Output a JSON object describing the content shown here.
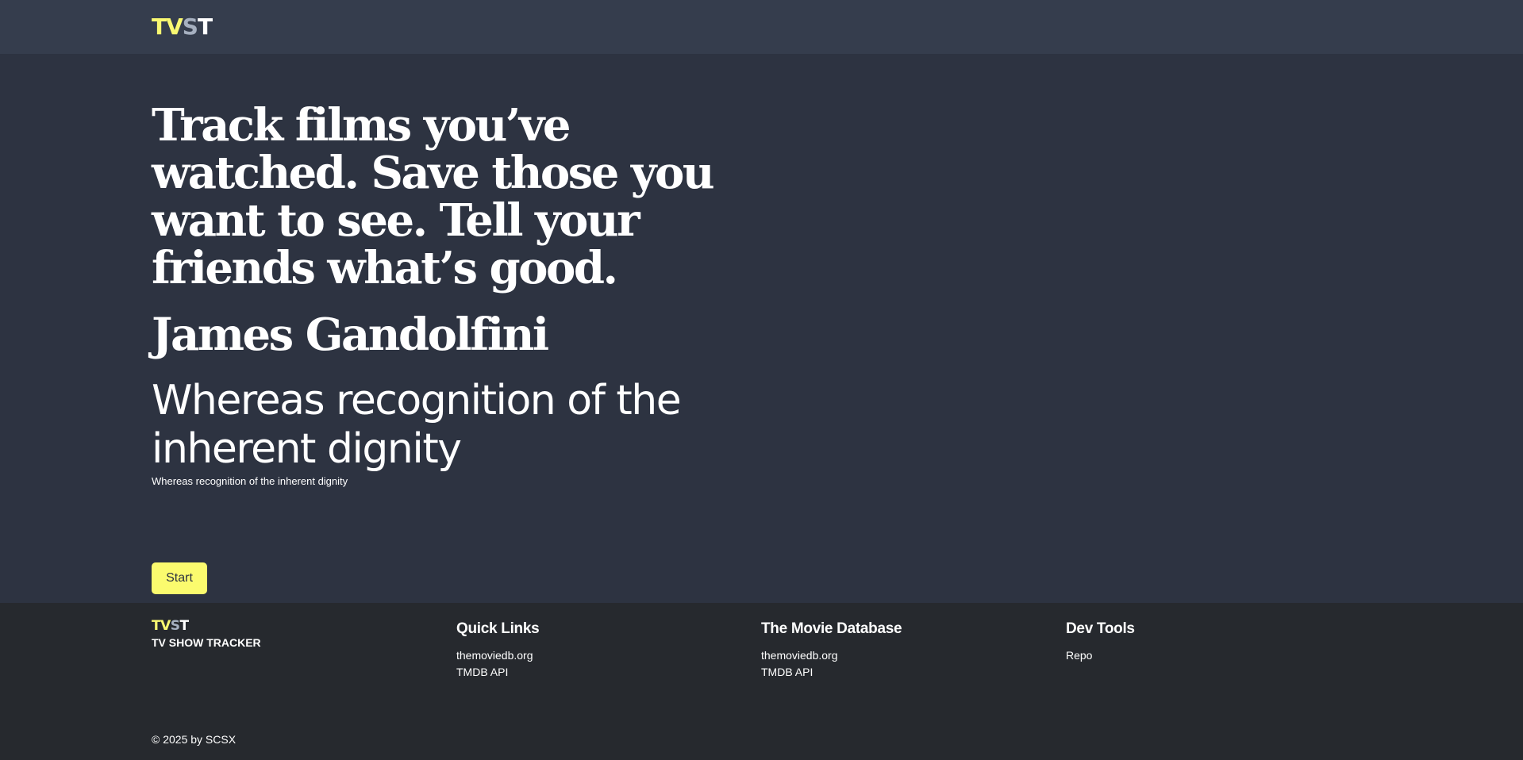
{
  "header": {
    "logo": {
      "tv": "TV",
      "s": "S",
      "t": "T"
    }
  },
  "hero": {
    "headline": "Track films you’ve watched. Save those you want to see. Tell your friends what’s good.",
    "author": "James Gandolfini",
    "subtitle": "Whereas recognition of the inherent dignity",
    "small_text": "Whereas recognition of the inherent dignity",
    "start_label": "Start"
  },
  "footer": {
    "logo": {
      "tv": "TV",
      "s": "S",
      "t": "T"
    },
    "tagline": "TV SHOW TRACKER",
    "columns": [
      {
        "title": "Quick Links",
        "links": [
          "themoviedb.org",
          "TMDB API"
        ]
      },
      {
        "title": "The Movie Database",
        "links": [
          "themoviedb.org",
          "TMDB API"
        ]
      },
      {
        "title": "Dev Tools",
        "links": [
          "Repo"
        ]
      }
    ],
    "copyright": "© 2025 by SCSX"
  },
  "colors": {
    "accent": "#fbfb6e",
    "header_bg": "#353d4d",
    "hero_bg": "#2d3341",
    "footer_bg": "#26292e",
    "logo_s": "#a6b0c0"
  }
}
